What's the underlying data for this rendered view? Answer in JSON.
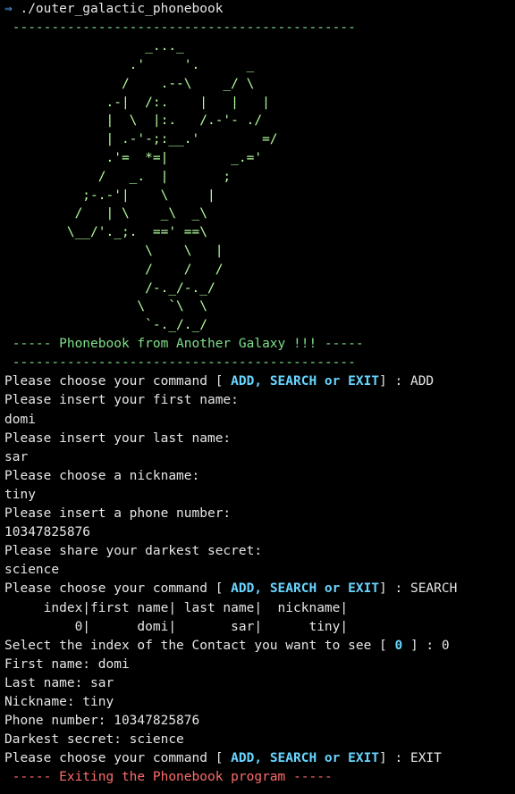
{
  "prompt": {
    "arrow": "⇒",
    "command": "./outer_galactic_phonebook"
  },
  "separator": " --------------------------------------------",
  "ascii_art": "                  _..._\n                .'     '.      _\n               /    .--\\    _/ \\\n             .-|  /:.    |   |   |\n             |  \\  |:.   /.-'- ./\n             | .-'-;:__.'        =/\n             .'=  *=|        _.='\n            /   _.  |       ;\n          ;-.-'|    \\     |\n         /   | \\    _\\  _\\\n        \\__/'._;.  ==' ==\\\n                  \\    \\   |\n                  /    /   /\n                  /-._/-._/\n                 \\   `\\  \\\n                  `-._/._/",
  "banner": " ----- Phonebook from Another Galaxy !!! -----",
  "command_prompt": {
    "prefix": "Please choose your command [ ",
    "options": "ADD, SEARCH or EXIT",
    "suffix": "] : "
  },
  "session": {
    "cmd1": "ADD",
    "ask_first_name": "Please insert your first name:",
    "first_name": "domi",
    "ask_last_name": "Please insert your last name:",
    "last_name": "sar",
    "ask_nickname": "Please choose a nickname:",
    "nickname": "tiny",
    "ask_phone": "Please insert a phone number:",
    "phone": "10347825876",
    "ask_secret": "Please share your darkest secret:",
    "secret": "science",
    "cmd2": "SEARCH",
    "table_header": "     index|first name| last name|  nickname|",
    "table_row": "         0|      domi|       sar|      tiny|",
    "select_prefix": "Select the index of the Contact you want to see [ ",
    "select_range": "0",
    "select_suffix": " ] : ",
    "select_value": "0",
    "detail_first": "First name: domi",
    "detail_last": "Last name: sar",
    "detail_nick": "Nickname: tiny",
    "detail_phone": "Phone number: 10347825876",
    "detail_secret": "Darkest secret: science",
    "cmd3": "EXIT",
    "exit_message": " ----- Exiting the Phonebook program -----"
  },
  "colors": {
    "background": "#000000",
    "text": "#e6e6e6",
    "green": "#7ee08a",
    "ascii": "#b4ff9e",
    "cyan": "#69d5ff",
    "red": "#ff6b6b",
    "prompt_arrow": "#5fa8ff"
  }
}
